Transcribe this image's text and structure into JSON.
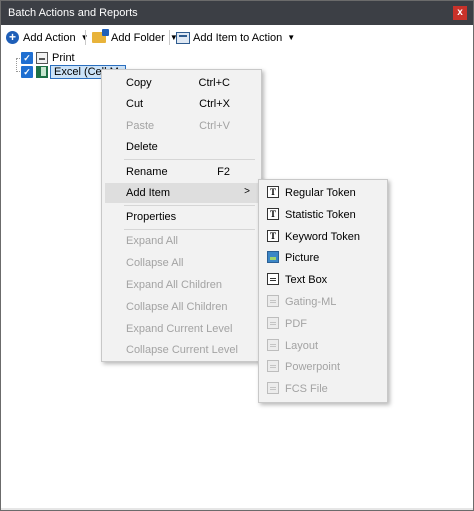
{
  "window": {
    "title": "Batch Actions and Reports",
    "close_glyph": "x"
  },
  "toolbar": {
    "add_action": "Add Action",
    "add_folder": "Add Folder",
    "add_item_to_action": "Add Item to Action"
  },
  "tree": {
    "items": [
      {
        "label": "Print",
        "icon": "printer-icon",
        "checked": true
      },
      {
        "label": "Excel (Cell Mode)",
        "icon": "excel-icon",
        "checked": true,
        "selected": true
      }
    ]
  },
  "context_menu": {
    "items": [
      {
        "label": "Copy",
        "shortcut": "Ctrl+C",
        "enabled": true
      },
      {
        "label": "Cut",
        "shortcut": "Ctrl+X",
        "enabled": true
      },
      {
        "label": "Paste",
        "shortcut": "Ctrl+V",
        "enabled": false
      },
      {
        "label": "Delete",
        "shortcut": "",
        "enabled": true
      },
      {
        "label": "Rename",
        "shortcut": "F2",
        "enabled": true
      },
      {
        "label": "Add Item",
        "shortcut": "",
        "enabled": true,
        "submenu": true,
        "highlighted": true
      },
      {
        "label": "Properties",
        "shortcut": "",
        "enabled": true
      },
      {
        "label": "Expand All",
        "shortcut": "",
        "enabled": false
      },
      {
        "label": "Collapse All",
        "shortcut": "",
        "enabled": false
      },
      {
        "label": "Expand All Children",
        "shortcut": "",
        "enabled": false
      },
      {
        "label": "Collapse All Children",
        "shortcut": "",
        "enabled": false
      },
      {
        "label": "Expand Current Level",
        "shortcut": "",
        "enabled": false
      },
      {
        "label": "Collapse Current Level",
        "shortcut": "",
        "enabled": false
      }
    ]
  },
  "add_item_submenu": {
    "items": [
      {
        "label": "Regular Token",
        "icon": "token-icon",
        "enabled": true
      },
      {
        "label": "Statistic Token",
        "icon": "token-icon",
        "enabled": true
      },
      {
        "label": "Keyword Token",
        "icon": "token-icon",
        "enabled": true
      },
      {
        "label": "Picture",
        "icon": "picture-icon",
        "enabled": true
      },
      {
        "label": "Text Box",
        "icon": "text-box-icon",
        "enabled": true
      },
      {
        "label": "Gating-ML",
        "icon": "gating-ml-icon",
        "enabled": false
      },
      {
        "label": "PDF",
        "icon": "pdf-icon",
        "enabled": false
      },
      {
        "label": "Layout",
        "icon": "layout-icon",
        "enabled": false
      },
      {
        "label": "Powerpoint",
        "icon": "powerpoint-icon",
        "enabled": false
      },
      {
        "label": "FCS File",
        "icon": "fcs-file-icon",
        "enabled": false
      }
    ]
  },
  "colors": {
    "titlebar": "#3c3f45",
    "close_button": "#c8322a",
    "accent": "#1f6fd1",
    "disabled_text": "#a3a3a3",
    "menu_background": "#f2f2f2"
  }
}
